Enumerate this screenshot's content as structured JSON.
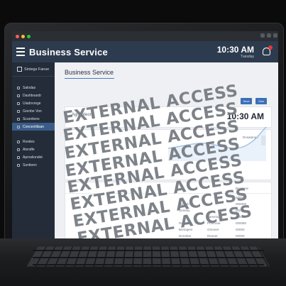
{
  "app": {
    "title": "Business Service",
    "time": "10:30 AM",
    "time_sub": "Tuesday"
  },
  "sidebar": {
    "header": "Sintegs Fanse",
    "items": [
      {
        "label": "Salodas",
        "active": false
      },
      {
        "label": "Dashboardr",
        "active": false
      },
      {
        "label": "Uiadovrege",
        "active": false
      },
      {
        "label": "Grenbe Von",
        "active": false
      },
      {
        "label": "Scurotions",
        "active": false
      },
      {
        "label": "Concentilisan",
        "active": true
      },
      {
        "label": "Rosites",
        "active": false
      },
      {
        "label": "Alsndfe",
        "active": false
      },
      {
        "label": "Aprosliondet",
        "active": false
      },
      {
        "label": "Suntieen",
        "active": false
      }
    ]
  },
  "main": {
    "title": "Business Service",
    "buttons": [
      "Seve",
      "Snw"
    ],
    "card_label": "Agrtcuteon",
    "card_time": "10:30 AM",
    "side_note": "Rosatanaci",
    "table": {
      "header": "Boartuse",
      "rows": [
        {
          "name": "",
          "status": "",
          "value": "00000"
        },
        {
          "name": "Tlostoh",
          "status": "",
          "value": "000000"
        },
        {
          "name": "Deneey",
          "status": "",
          "value": "00009"
        },
        {
          "name": "",
          "status": "Vareeing",
          "value": "000080"
        },
        {
          "name": "Reneboe",
          "status": "Proerone",
          "value": "000080"
        },
        {
          "name": "Bnrlogest",
          "status": "Oreneel",
          "value": "00000"
        },
        {
          "name": "Drresber",
          "status": "Reeeet",
          "value": "00000"
        }
      ]
    }
  },
  "watermark": {
    "lines": [
      "EXTERNAL ACCESS",
      "EXTERNAL ACCESS",
      "EXTERNAL ACCESS",
      "EXTERNAL ACCESS",
      "EXTERNAL ACCESS",
      "EXTERNAL ACCESS",
      "EXTERNAL ACCESS",
      "EXTERNAL ACCESS"
    ]
  },
  "colors": {
    "header": "#2d3b4e",
    "sidebar": "#232c38",
    "accent": "#3b6fb6",
    "window_close": "#ff5f57",
    "window_min": "#febc2e",
    "window_max": "#28c840",
    "alert": "#e53935"
  }
}
